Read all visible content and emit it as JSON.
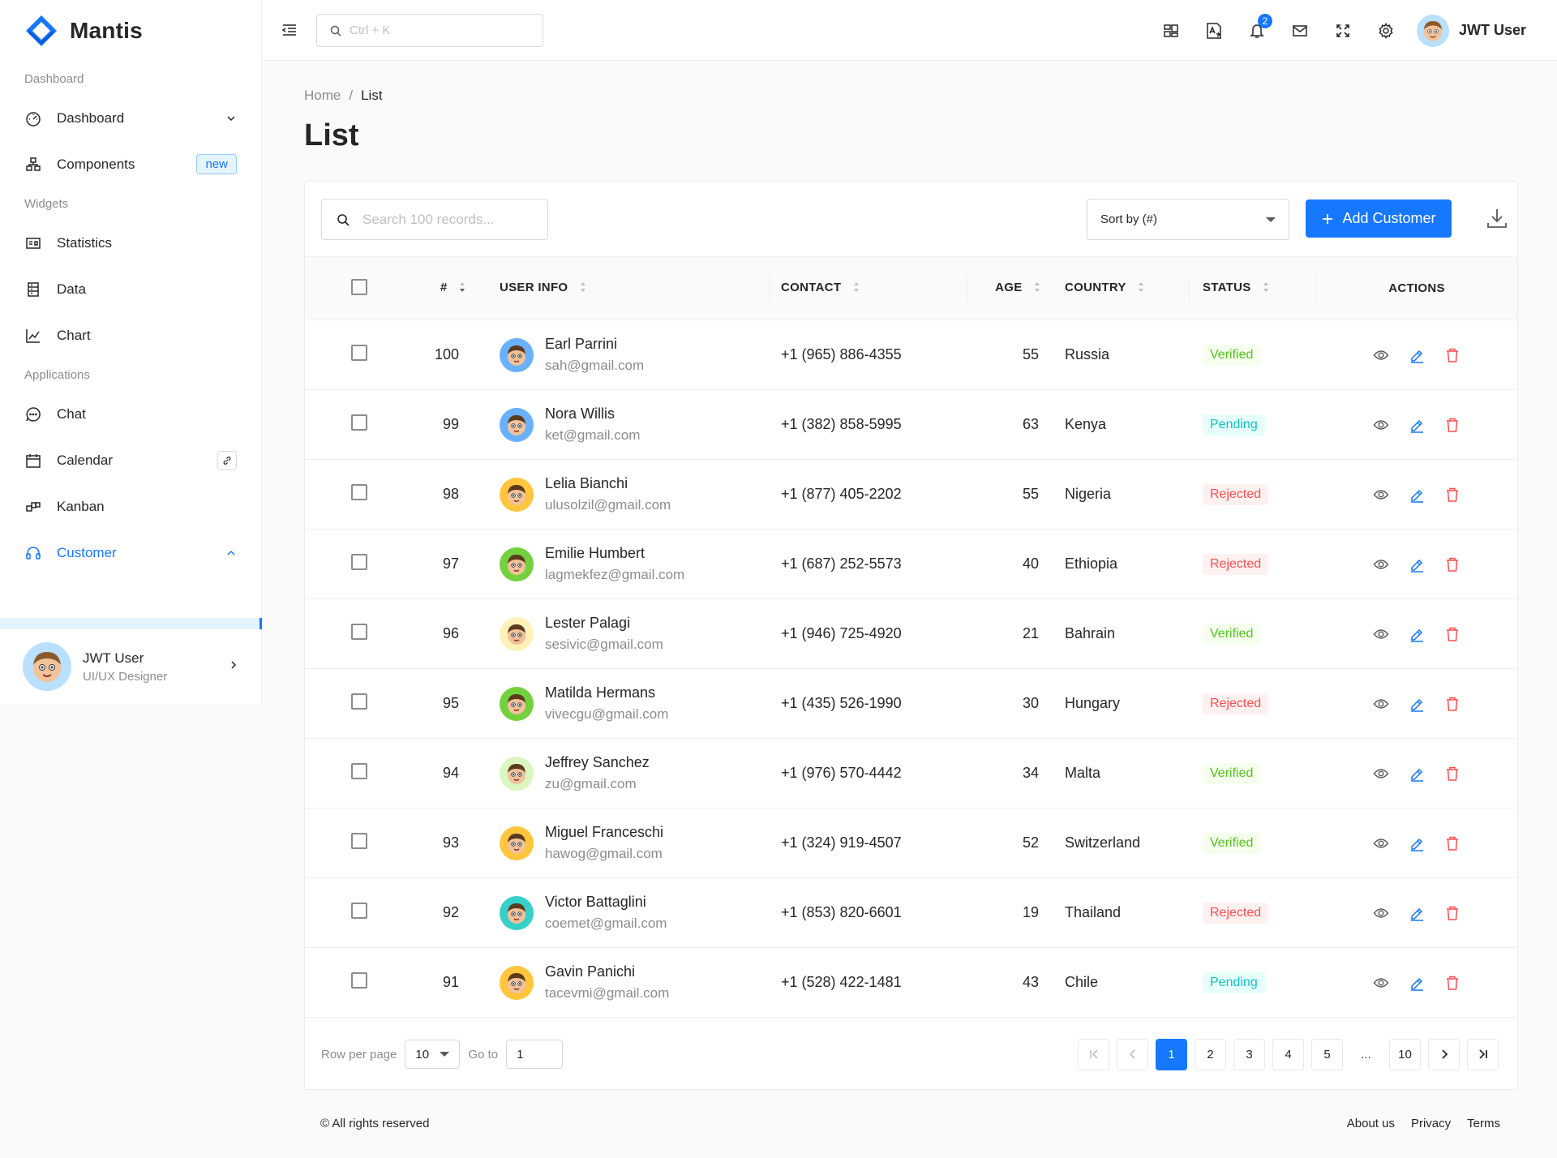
{
  "brand": {
    "name": "Mantis",
    "color": "#1677ff"
  },
  "sidebar": {
    "sections": [
      {
        "label": "Dashboard"
      },
      {
        "label": "Widgets"
      },
      {
        "label": "Applications"
      }
    ],
    "items": [
      {
        "label": "Dashboard",
        "icon": "dashboard-icon"
      },
      {
        "label": "Components",
        "icon": "components-icon",
        "badge": "new"
      },
      {
        "label": "Statistics",
        "icon": "statistics-icon"
      },
      {
        "label": "Data",
        "icon": "data-icon"
      },
      {
        "label": "Chart",
        "icon": "chart-icon"
      },
      {
        "label": "Chat",
        "icon": "chat-icon"
      },
      {
        "label": "Calendar",
        "icon": "calendar-icon"
      },
      {
        "label": "Kanban",
        "icon": "kanban-icon"
      },
      {
        "label": "Customer",
        "icon": "customer-icon",
        "active": true
      }
    ],
    "user": {
      "name": "JWT User",
      "role": "UI/UX Designer"
    }
  },
  "header": {
    "search_placeholder": "Ctrl + K",
    "notification_count": "2",
    "user_name": "JWT User"
  },
  "page": {
    "breadcrumb": {
      "home": "Home",
      "sep": "/",
      "current": "List"
    },
    "title": "List"
  },
  "toolbar": {
    "search_placeholder": "Search 100 records...",
    "sort_label": "Sort by (#)",
    "add_label": "Add Customer"
  },
  "table": {
    "columns": [
      "#",
      "USER INFO",
      "CONTACT",
      "AGE",
      "COUNTRY",
      "STATUS",
      "ACTIONS"
    ],
    "rows": [
      {
        "id": "100",
        "name": "Earl Parrini",
        "email": "sah@gmail.com",
        "contact": "+1 (965) 886-4355",
        "age": "55",
        "country": "Russia",
        "status": "Verified",
        "avatar_bg": "#69b1ff"
      },
      {
        "id": "99",
        "name": "Nora Willis",
        "email": "ket@gmail.com",
        "contact": "+1 (382) 858-5995",
        "age": "63",
        "country": "Kenya",
        "status": "Pending",
        "avatar_bg": "#69b1ff"
      },
      {
        "id": "98",
        "name": "Lelia Bianchi",
        "email": "ulusolzil@gmail.com",
        "contact": "+1 (877) 405-2202",
        "age": "55",
        "country": "Nigeria",
        "status": "Rejected",
        "avatar_bg": "#ffc53d"
      },
      {
        "id": "97",
        "name": "Emilie Humbert",
        "email": "lagmekfez@gmail.com",
        "contact": "+1 (687) 252-5573",
        "age": "40",
        "country": "Ethiopia",
        "status": "Rejected",
        "avatar_bg": "#73d13d"
      },
      {
        "id": "96",
        "name": "Lester Palagi",
        "email": "sesivic@gmail.com",
        "contact": "+1 (946) 725-4920",
        "age": "21",
        "country": "Bahrain",
        "status": "Verified",
        "avatar_bg": "#fff1b8"
      },
      {
        "id": "95",
        "name": "Matilda Hermans",
        "email": "vivecgu@gmail.com",
        "contact": "+1 (435) 526-1990",
        "age": "30",
        "country": "Hungary",
        "status": "Rejected",
        "avatar_bg": "#73d13d"
      },
      {
        "id": "94",
        "name": "Jeffrey Sanchez",
        "email": "zu@gmail.com",
        "contact": "+1 (976) 570-4442",
        "age": "34",
        "country": "Malta",
        "status": "Verified",
        "avatar_bg": "#d9f7be"
      },
      {
        "id": "93",
        "name": "Miguel Franceschi",
        "email": "hawog@gmail.com",
        "contact": "+1 (324) 919-4507",
        "age": "52",
        "country": "Switzerland",
        "status": "Verified",
        "avatar_bg": "#ffc53d"
      },
      {
        "id": "92",
        "name": "Victor Battaglini",
        "email": "coemet@gmail.com",
        "contact": "+1 (853) 820-6601",
        "age": "19",
        "country": "Thailand",
        "status": "Rejected",
        "avatar_bg": "#36cfc9"
      },
      {
        "id": "91",
        "name": "Gavin Panichi",
        "email": "tacevmi@gmail.com",
        "contact": "+1 (528) 422-1481",
        "age": "43",
        "country": "Chile",
        "status": "Pending",
        "avatar_bg": "#ffc53d"
      }
    ]
  },
  "pagination": {
    "rows_label": "Row per page",
    "rows_value": "10",
    "goto_label": "Go to",
    "goto_value": "1",
    "pages": [
      "1",
      "2",
      "3",
      "4",
      "5",
      "...",
      "10"
    ],
    "current": "1"
  },
  "footer": {
    "copyright": "© All rights reserved",
    "links": [
      "About us",
      "Privacy",
      "Terms"
    ]
  },
  "colors": {
    "verified": "#52c41a",
    "pending": "#13c2c2",
    "rejected": "#ff4d4f",
    "primary": "#1677ff"
  }
}
